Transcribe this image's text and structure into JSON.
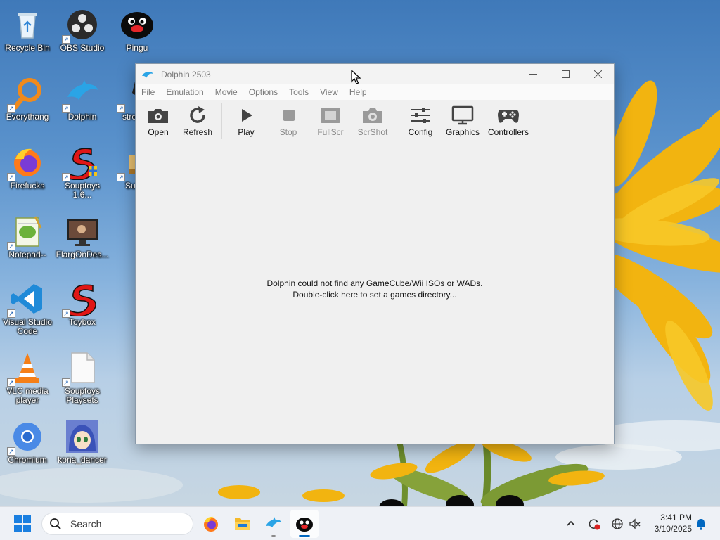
{
  "desktop": {
    "icons": [
      {
        "label": "Recycle Bin",
        "icon": "recycle-bin-icon",
        "shortcut": false
      },
      {
        "label": "OBS Studio",
        "icon": "obs-studio-icon",
        "shortcut": true
      },
      {
        "label": "Pingu",
        "icon": "pingu-icon",
        "shortcut": false
      },
      {
        "label": "Everythang",
        "icon": "everything-search-icon",
        "shortcut": true
      },
      {
        "label": "Dolphin",
        "icon": "dolphin-icon",
        "shortcut": true
      },
      {
        "label": "stress...",
        "icon": "stress-icon",
        "shortcut": true
      },
      {
        "label": "Firefucks",
        "icon": "firefox-icon",
        "shortcut": true
      },
      {
        "label": "Souptoys 1.6...",
        "icon": "souptoys-icon",
        "shortcut": true
      },
      {
        "label": "Suni...",
        "icon": "suni-icon",
        "shortcut": true
      },
      {
        "label": "Notepad--",
        "icon": "notepad-icon",
        "shortcut": true
      },
      {
        "label": "FlargOnDes...",
        "icon": "flarg-monitor-icon",
        "shortcut": false
      },
      {
        "label": "Visual Studio Code",
        "icon": "vscode-icon",
        "shortcut": true
      },
      {
        "label": "Toybox",
        "icon": "toybox-icon",
        "shortcut": true
      },
      {
        "label": "VLC media player",
        "icon": "vlc-icon",
        "shortcut": true
      },
      {
        "label": "Souptoys Playsets",
        "icon": "file-icon",
        "shortcut": true
      },
      {
        "label": "Chromium",
        "icon": "chromium-icon",
        "shortcut": true
      },
      {
        "label": "kona_dancer",
        "icon": "kona-dancer-icon",
        "shortcut": false
      }
    ]
  },
  "window": {
    "title": "Dolphin 2503",
    "menu": [
      "File",
      "Emulation",
      "Movie",
      "Options",
      "Tools",
      "View",
      "Help"
    ],
    "toolbar": {
      "open": "Open",
      "refresh": "Refresh",
      "play": "Play",
      "stop": "Stop",
      "fullscr": "FullScr",
      "scrshot": "ScrShot",
      "config": "Config",
      "graphics": "Graphics",
      "controllers": "Controllers"
    },
    "empty_message_line1": "Dolphin could not find any GameCube/Wii ISOs or WADs.",
    "empty_message_line2": "Double-click here to set a games directory..."
  },
  "taskbar": {
    "search_placeholder": "Search",
    "time": "3:41 PM",
    "date": "3/10/2025"
  },
  "colors": {
    "accent": "#0067c0",
    "dolphin_blue": "#2aa4e6"
  }
}
